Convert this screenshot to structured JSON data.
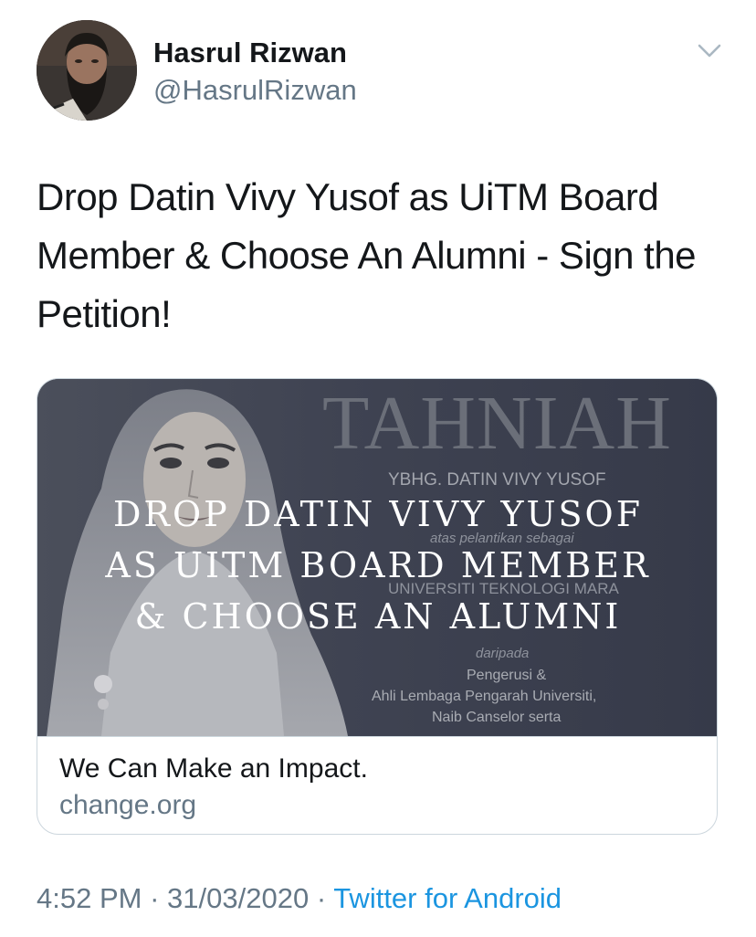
{
  "author": {
    "name": "Hasrul Rizwan",
    "handle": "@HasrulRizwan",
    "avatar_icon": "profile-photo"
  },
  "menu_icon": "chevron-down-icon",
  "tweet": {
    "text": "Drop Datin Vivy Yusof as UiTM Board Member & Choose An Alumni - Sign the Petition!"
  },
  "card": {
    "image": {
      "background_heading": "TAHNIAH",
      "background_name": "YBHG. DATIN VIVY YUSOF",
      "background_line1": "atas pelantikan sebagai",
      "background_line2": "UNIVERSITI TEKNOLOGI MARA",
      "background_line3": "daripada",
      "background_line4": "Pengerusi &",
      "background_line5": "Ahli Lembaga Pengarah Universiti,",
      "background_line6": "Naib Canselor serta",
      "overlay_lines": [
        "DROP DATIN VIVY YUSOF",
        "AS UITM BOARD MEMBER",
        "& CHOOSE AN ALUMNI"
      ]
    },
    "title": "We Can Make an Impact.",
    "domain": "change.org"
  },
  "footer": {
    "time": "4:52 PM",
    "separator": "·",
    "date": "31/03/2020",
    "source": "Twitter for Android"
  },
  "colors": {
    "text_primary": "#14171a",
    "text_secondary": "#657786",
    "link": "#1b95e0",
    "border": "#ccd6dd"
  }
}
